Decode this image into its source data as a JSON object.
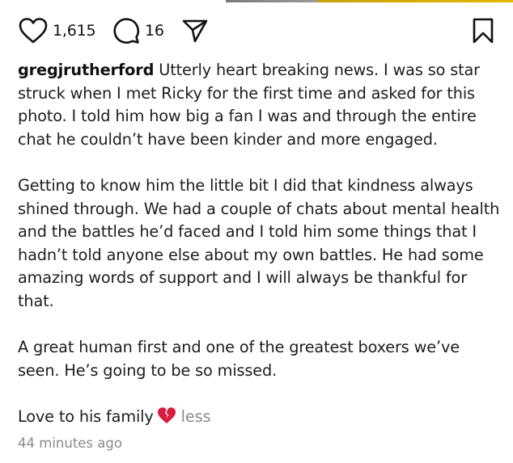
{
  "actions": {
    "likes": "1,615",
    "comments": "16",
    "like_icon": "heart-icon",
    "comment_icon": "comment-bubble-icon",
    "share_icon": "send-arrow-icon",
    "save_icon": "bookmark-icon"
  },
  "caption": {
    "username": "gregjrutherford",
    "paragraph1": "Utterly heart breaking news. I was so star struck when I met Ricky for the first time and asked for this photo. I told him how big a fan I was and through the entire chat he couldn’t have been kinder and more engaged.",
    "paragraph2": "Getting to know him the little bit I did that kindness always shined through. We had a couple of chats about mental health and the battles he’d faced and I told him some things that I hadn’t told anyone else about my own battles. He had some amazing words of support and I will always be thankful for that.",
    "paragraph3": "A great human first and one of the greatest boxers we’ve seen. He’s going to be so missed.",
    "paragraph4": "Love to his family",
    "emoji_icon": "broken-heart-icon",
    "more_label": "less"
  },
  "timestamp": "44 minutes ago",
  "colors": {
    "text": "#1d1d1d",
    "muted": "#8a8a8a",
    "emoji": "#d81b3f"
  }
}
